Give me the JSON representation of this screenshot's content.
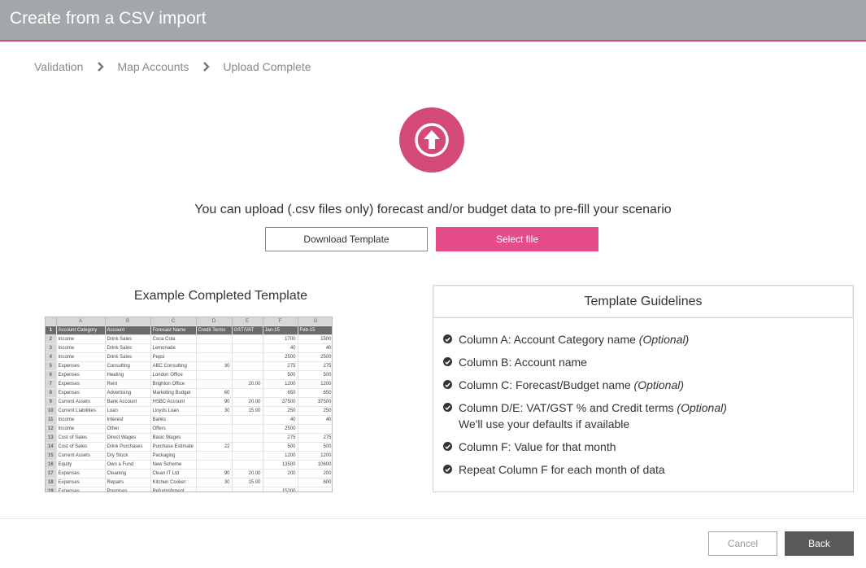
{
  "header": {
    "title": "Create from a CSV import"
  },
  "breadcrumb": {
    "steps": [
      "Validation",
      "Map Accounts",
      "Upload Complete"
    ]
  },
  "upload": {
    "icon": "upload-arrow-icon",
    "intro": "You can upload (.csv files only) forecast and/or budget data to pre-fill your scenario",
    "download_label": "Download Template",
    "select_label": "Select file"
  },
  "example": {
    "title": "Example Completed Template",
    "column_letters": [
      "A",
      "B",
      "C",
      "D",
      "E",
      "F",
      "G"
    ],
    "headers": [
      "Account Category",
      "Account",
      "Forecast Name",
      "Credit Terms",
      "GST/VAT",
      "Jan-15",
      "Feb-15"
    ],
    "rows": [
      [
        "2",
        "Income",
        "Drink Sales",
        "Coca Cola",
        "",
        "",
        "1700",
        "1500"
      ],
      [
        "3",
        "Income",
        "Drink Sales",
        "Lemonade",
        "",
        "",
        "40",
        "40"
      ],
      [
        "4",
        "Income",
        "Drink Sales",
        "Pepsi",
        "",
        "",
        "2500",
        "2500"
      ],
      [
        "5",
        "Expenses",
        "Consulting",
        "ABC Consulting",
        "30",
        "",
        "275",
        "275"
      ],
      [
        "6",
        "Expenses",
        "Heating",
        "London Office",
        "",
        "",
        "500",
        "500"
      ],
      [
        "7",
        "Expenses",
        "Rent",
        "Brighton Office",
        "",
        "20.00",
        "1200",
        "1200"
      ],
      [
        "8",
        "Expenses",
        "Advertising",
        "Marketing Budget",
        "60",
        "",
        "650",
        "650"
      ],
      [
        "9",
        "Current Assets",
        "Bank Account",
        "HSBC Account",
        "90",
        "20.00",
        "37500",
        "37500"
      ],
      [
        "10",
        "Current Liabilities",
        "Loan",
        "Lloyds Loan",
        "30",
        "15.00",
        "250",
        "250"
      ],
      [
        "11",
        "Income",
        "Interest",
        "Banks",
        "",
        "",
        "40",
        "40"
      ],
      [
        "12",
        "Income",
        "Other",
        "Offers",
        "",
        "",
        "2500",
        ""
      ],
      [
        "13",
        "Cost of Sales",
        "Direct Wages",
        "Basic Wages",
        "",
        "",
        "275",
        "275"
      ],
      [
        "14",
        "Cost of Sales",
        "Drink Purchases",
        "Purchase Estimate",
        "22",
        "",
        "500",
        "500"
      ],
      [
        "15",
        "Current Assets",
        "Dry Stock",
        "Packaging",
        "",
        "",
        "1200",
        "1200"
      ],
      [
        "16",
        "Equity",
        "Own a Fund",
        "New Scheme",
        "",
        "",
        "13500",
        "10600"
      ],
      [
        "17",
        "Expenses",
        "Cleaning",
        "Clean IT Ltd",
        "90",
        "20.00",
        "200",
        "200"
      ],
      [
        "18",
        "Expenses",
        "Repairs",
        "Kitchen Cooker",
        "30",
        "15.00",
        "",
        "600"
      ],
      [
        "19",
        "Expenses",
        "Premises",
        "Refurbishment",
        "",
        "",
        "15200",
        ""
      ]
    ]
  },
  "guidelines": {
    "title": "Template Guidelines",
    "items": [
      {
        "text": "Column A: Account Category name ",
        "optional": "(Optional)",
        "sub": ""
      },
      {
        "text": "Column B: Account name",
        "optional": "",
        "sub": ""
      },
      {
        "text": "Column C: Forecast/Budget name ",
        "optional": "(Optional)",
        "sub": ""
      },
      {
        "text": "Column D/E: VAT/GST % and Credit terms ",
        "optional": "(Optional)",
        "sub": "We'll use your defaults if available"
      },
      {
        "text": "Column F: Value for that month",
        "optional": "",
        "sub": ""
      },
      {
        "text": "Repeat Column F for each month of data",
        "optional": "",
        "sub": ""
      }
    ]
  },
  "footer": {
    "cancel_label": "Cancel",
    "back_label": "Back"
  },
  "colors": {
    "accent": "#e74c8a",
    "icon": "#d3497a",
    "header_bg": "#a3a7aa"
  }
}
